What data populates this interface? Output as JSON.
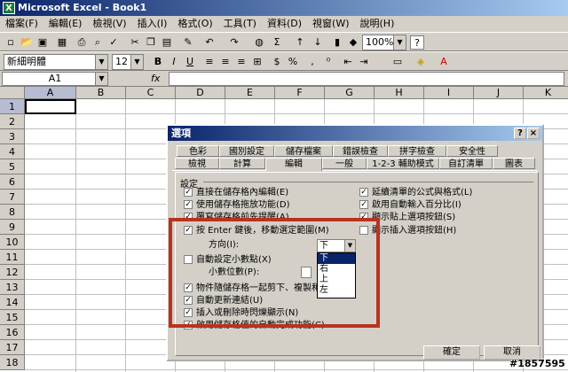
{
  "window": {
    "title": "Microsoft Excel - Book1",
    "app_icon": "excel-icon"
  },
  "menu": [
    "檔案(F)",
    "編輯(E)",
    "檢視(V)",
    "插入(I)",
    "格式(O)",
    "工具(T)",
    "資料(D)",
    "視窗(W)",
    "說明(H)"
  ],
  "toolbar": {
    "zoom": "100%",
    "font_name": "新細明體",
    "font_size": "12",
    "bold": "B",
    "italic": "I",
    "underline": "U",
    "dollar": "$",
    "percent": "%",
    "sigma": "Σ",
    "help": "?"
  },
  "formula_bar": {
    "name_box": "A1",
    "fx": "fx",
    "value": ""
  },
  "grid": {
    "columns": [
      "A",
      "B",
      "C",
      "D",
      "E",
      "F",
      "G",
      "H",
      "I",
      "J",
      "K"
    ],
    "rows": [
      "1",
      "2",
      "3",
      "4",
      "5",
      "6",
      "7",
      "8",
      "9",
      "10",
      "11",
      "12",
      "13",
      "14",
      "15",
      "16",
      "17",
      "18"
    ],
    "selected": "A1"
  },
  "dialog": {
    "title": "選項",
    "help_btn": "?",
    "close_btn": "×",
    "tabs_row1": [
      "色彩",
      "國別設定",
      "儲存檔案",
      "錯誤檢查",
      "拼字檢查",
      "安全性"
    ],
    "tabs_row2": [
      "檢視",
      "計算",
      "編輯",
      "一般",
      "1-2-3 輔助模式",
      "自訂清單",
      "圖表"
    ],
    "active_tab": "編輯",
    "group_label": "設定",
    "left_options": [
      {
        "label": "直接在儲存格內編輯(E)",
        "checked": true
      },
      {
        "label": "使用儲存格拖放功能(D)",
        "checked": true
      },
      {
        "label": "覆寫儲存格前先提醒(A)",
        "checked": true
      },
      {
        "label": "按 Enter 鍵後，移動選定範圍(M)",
        "checked": true
      },
      {
        "label": "自動設定小數點(X)",
        "checked": false
      },
      {
        "label": "物件隨儲存格一起剪下、複製和排序(O)",
        "checked": true
      },
      {
        "label": "自動更新連結(U)",
        "checked": true
      },
      {
        "label": "插入或刪除時閃爍顯示(N)",
        "checked": true
      },
      {
        "label": "啟用儲存格值的自動完成功能(C)",
        "checked": true
      }
    ],
    "right_options": [
      {
        "label": "延續清單的公式與格式(L)",
        "checked": true
      },
      {
        "label": "啟用自動輸入百分比(I)",
        "checked": true
      },
      {
        "label": "顯示貼上選項按鈕(S)",
        "checked": true
      },
      {
        "label": "顯示插入選項按鈕(H)",
        "checked": false
      }
    ],
    "direction_label": "方向(I):",
    "direction_value": "下",
    "direction_options": [
      "下",
      "右",
      "上",
      "左"
    ],
    "decimal_label": "小數位數(P):",
    "ok": "確定",
    "cancel": "取消"
  },
  "watermark": "#1857595",
  "colors": {
    "highlight": "#b8331f",
    "titlebar": "#0a246a"
  }
}
